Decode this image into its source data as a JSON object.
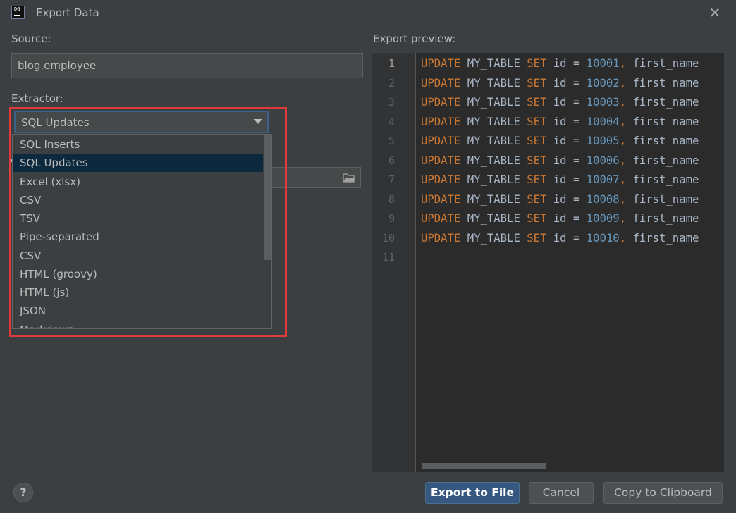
{
  "window": {
    "title": "Export Data",
    "app_icon_label": "DG"
  },
  "source": {
    "label": "Source:",
    "value": "blog.employee"
  },
  "extractor": {
    "label": "Extractor:",
    "selected": "SQL Updates",
    "options": [
      "SQL Inserts",
      "SQL Updates",
      "Excel (xlsx)",
      "CSV",
      "TSV",
      "Pipe-separated",
      "CSV",
      "HTML (groovy)",
      "HTML (js)",
      "JSON",
      "Markdown"
    ],
    "highlighted_index": 1
  },
  "preview": {
    "label": "Export preview:",
    "line_numbers": [
      "1",
      "2",
      "3",
      "4",
      "5",
      "6",
      "7",
      "8",
      "9",
      "10",
      "11"
    ],
    "lines": [
      {
        "k1": "UPDATE",
        "t1": " MY_TABLE ",
        "k2": "SET",
        "t2": " id = ",
        "num": "10001",
        "k3": ",",
        "t3": " first_name"
      },
      {
        "k1": "UPDATE",
        "t1": " MY_TABLE ",
        "k2": "SET",
        "t2": " id = ",
        "num": "10002",
        "k3": ",",
        "t3": " first_name"
      },
      {
        "k1": "UPDATE",
        "t1": " MY_TABLE ",
        "k2": "SET",
        "t2": " id = ",
        "num": "10003",
        "k3": ",",
        "t3": " first_name"
      },
      {
        "k1": "UPDATE",
        "t1": " MY_TABLE ",
        "k2": "SET",
        "t2": " id = ",
        "num": "10004",
        "k3": ",",
        "t3": " first_name"
      },
      {
        "k1": "UPDATE",
        "t1": " MY_TABLE ",
        "k2": "SET",
        "t2": " id = ",
        "num": "10005",
        "k3": ",",
        "t3": " first_name"
      },
      {
        "k1": "UPDATE",
        "t1": " MY_TABLE ",
        "k2": "SET",
        "t2": " id = ",
        "num": "10006",
        "k3": ",",
        "t3": " first_name"
      },
      {
        "k1": "UPDATE",
        "t1": " MY_TABLE ",
        "k2": "SET",
        "t2": " id = ",
        "num": "10007",
        "k3": ",",
        "t3": " first_name"
      },
      {
        "k1": "UPDATE",
        "t1": " MY_TABLE ",
        "k2": "SET",
        "t2": " id = ",
        "num": "10008",
        "k3": ",",
        "t3": " first_name"
      },
      {
        "k1": "UPDATE",
        "t1": " MY_TABLE ",
        "k2": "SET",
        "t2": " id = ",
        "num": "10009",
        "k3": ",",
        "t3": " first_name"
      },
      {
        "k1": "UPDATE",
        "t1": " MY_TABLE ",
        "k2": "SET",
        "t2": " id = ",
        "num": "10010",
        "k3": ",",
        "t3": " first_name"
      }
    ]
  },
  "buttons": {
    "help": "?",
    "export": "Export to File",
    "cancel": "Cancel",
    "copy": "Copy to Clipboard"
  },
  "icons": {
    "close": "close-icon",
    "folder": "folder-icon",
    "dropdown": "chevron-down-icon",
    "app": "datagrip-icon"
  },
  "colors": {
    "highlight": "#e03b3b",
    "keyword": "#cc7832",
    "number": "#6897bb",
    "primary_button": "#365880",
    "selection": "#0d293e"
  }
}
